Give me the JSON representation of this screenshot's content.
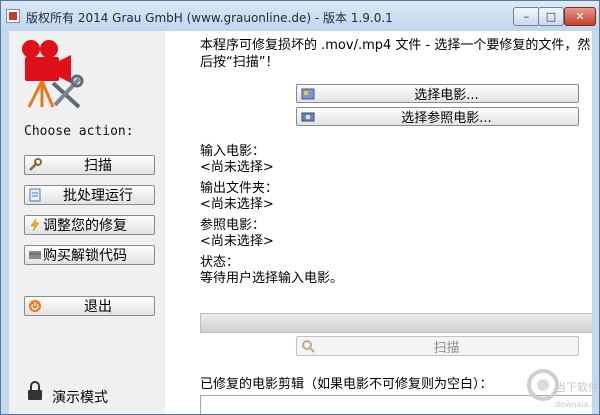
{
  "window": {
    "title": "版权所有 2014 Grau GmbH (www.grauonline.de) - 版本 1.9.0.1",
    "controls": {
      "minimize": "–",
      "maximize": "□",
      "close": "✕"
    }
  },
  "sidebar": {
    "choose_label": "Choose action:",
    "buttons": [
      {
        "label": "扫描",
        "icon": "wrench-icon"
      },
      {
        "label": "批处理运行",
        "icon": "document-icon"
      },
      {
        "label": "调整您的修复",
        "icon": "lightning-icon"
      },
      {
        "label": "购买解锁代码",
        "icon": "cart-icon"
      },
      {
        "label": "退出",
        "icon": "power-icon"
      }
    ],
    "demo_label": "演示模式"
  },
  "main": {
    "instructions": "本程序可修复损坏的 .mov/.mp4 文件 - 选择一个要修复的文件，然后按“扫描”！",
    "select_movie_button": "选择电影...",
    "select_reference_button": "选择参照电影...",
    "input_movie": {
      "label": "输入电影：",
      "value": "<尚未选择>"
    },
    "output_folder": {
      "label": "输出文件夹：",
      "value": "<尚未选择>"
    },
    "reference_movie": {
      "label": "参照电影：",
      "value": "<尚未选择>"
    },
    "status": {
      "label": "状态：",
      "value": "等待用户选择输入电影。"
    },
    "progress": 0,
    "scan_button": "扫描",
    "repaired_label": "已修复的电影剪辑（如果电影不可修复则为空白）：",
    "repaired_list": []
  },
  "watermark": {
    "text": "当下软件园",
    "url": "downxia.com"
  },
  "colors": {
    "titlebar": "#c4d8ee",
    "close_button": "#c4402c",
    "sidebar_bg": "#f0f0f0",
    "logo_red": "#e0101a",
    "logo_orange": "#e67a1a"
  }
}
